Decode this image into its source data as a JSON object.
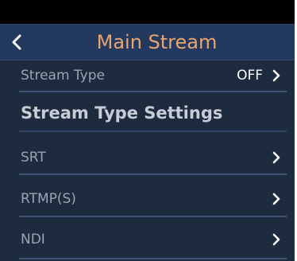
{
  "header": {
    "title": "Main Stream"
  },
  "stream_type": {
    "label": "Stream Type",
    "value": "OFF"
  },
  "section": {
    "title": "Stream Type Settings"
  },
  "menu": [
    {
      "label": "SRT"
    },
    {
      "label": "RTMP(S)"
    },
    {
      "label": "NDI"
    }
  ],
  "icons": {
    "back": "chevron-left-icon",
    "forward": "chevron-right-icon"
  },
  "colors": {
    "title": "#e7a570",
    "header_bg": "#23395f",
    "background": "#1e2a3d",
    "divider": "#3e5479"
  }
}
